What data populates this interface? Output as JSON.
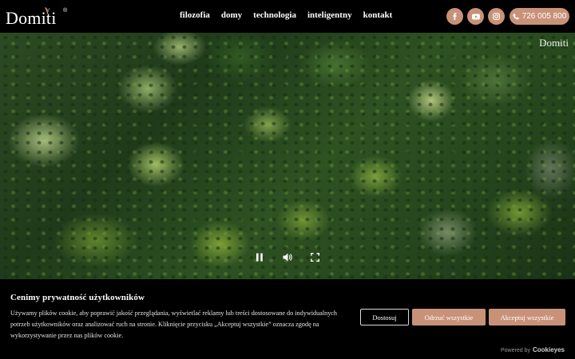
{
  "header": {
    "logo_text": "Domiti",
    "logo_mark": "®",
    "nav": [
      {
        "label": "filozofia"
      },
      {
        "label": "domy"
      },
      {
        "label": "technologia"
      },
      {
        "label": "inteligentny"
      },
      {
        "label": "kontakt"
      }
    ],
    "social": [
      {
        "icon": "facebook-icon"
      },
      {
        "icon": "youtube-icon"
      },
      {
        "icon": "instagram-icon"
      }
    ],
    "phone": {
      "icon": "phone-icon",
      "label": "726 005 800"
    }
  },
  "hero": {
    "watermark": "Domiti",
    "controls": {
      "pause": "pause-icon",
      "volume": "volume-icon",
      "fullscreen": "fullscreen-icon"
    }
  },
  "cookie_banner": {
    "title": "Cenimy prywatność użytkowników",
    "text": "Używamy plików cookie, aby poprawić jakość przeglądania, wyświetlać reklamy lub treści dostosowane do indywidualnych potrzeb użytkowników oraz analizować ruch na stronie. Kliknięcie przycisku „Akceptuj wszystkie” oznacza zgodę na wykorzystywanie przez nas plików cookie.",
    "buttons": {
      "customize": "Dostosuj",
      "reject": "Odrzuć wszystkie",
      "accept": "Akceptuj wszystkie"
    },
    "powered_by": "Powered by",
    "powered_brand": "Cookieyes"
  },
  "colors": {
    "accent": "#c89279",
    "background": "#000000"
  }
}
